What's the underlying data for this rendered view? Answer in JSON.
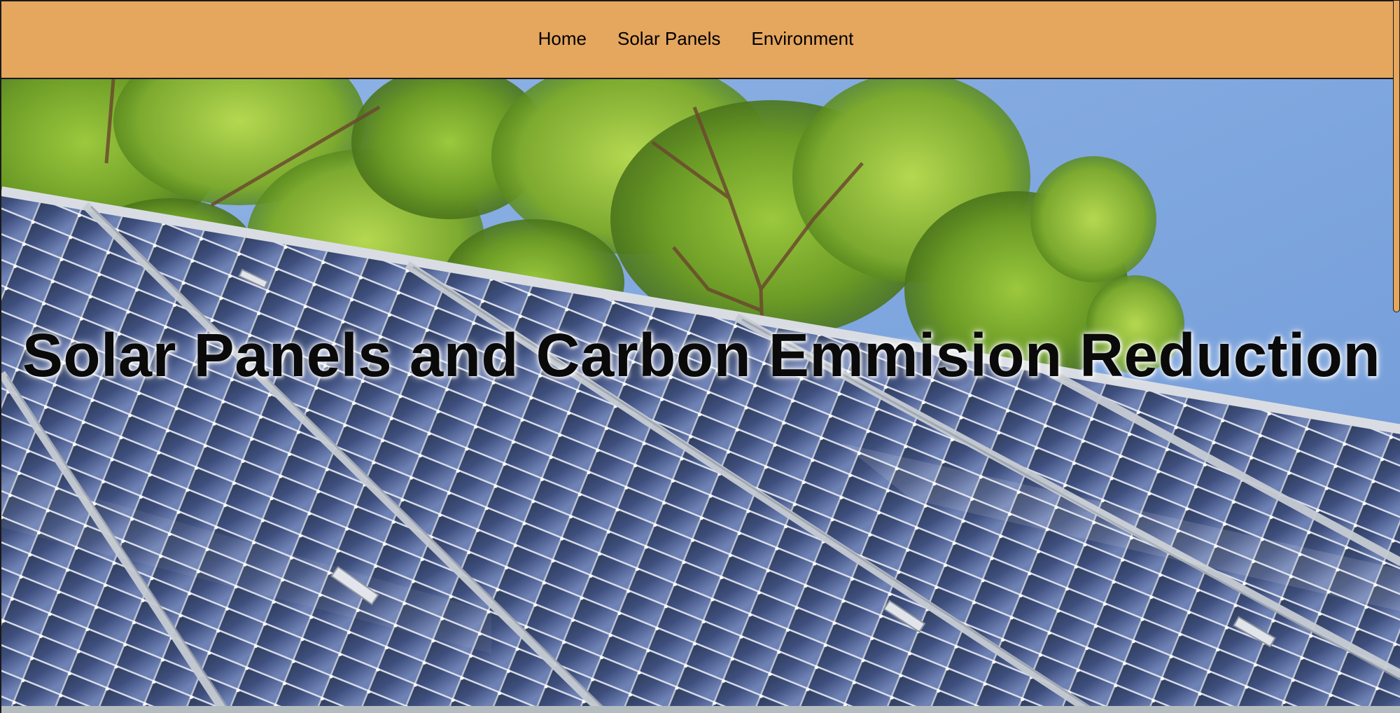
{
  "nav": {
    "links": [
      "Home",
      "Solar Panels",
      "Environment"
    ]
  },
  "hero": {
    "title": "Solar Panels and Carbon Emmision Reduction",
    "image_description_icon": "solar-panels-photo"
  },
  "colors": {
    "nav_background": "#e5a65e",
    "nav_border": "#1a1a1a",
    "text": "#000000"
  }
}
